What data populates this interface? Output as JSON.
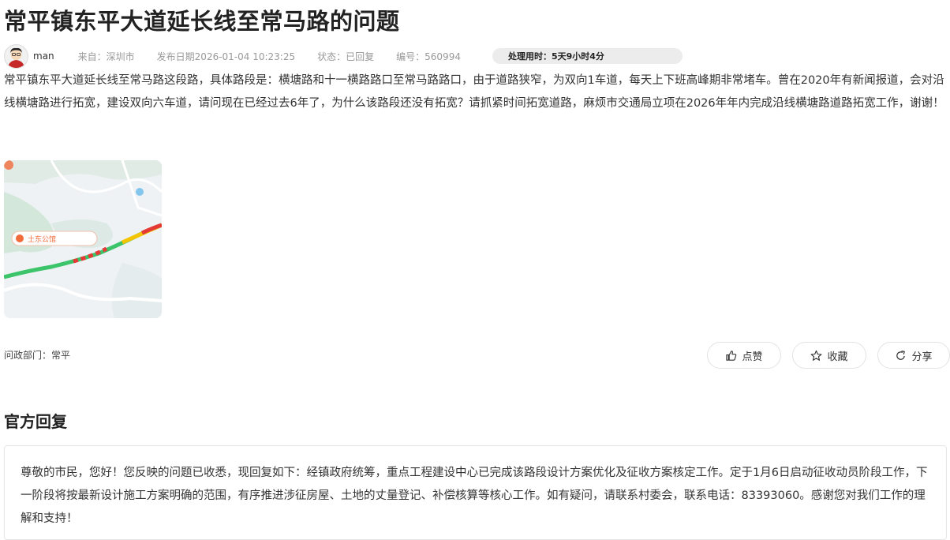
{
  "page": {
    "title": "常平镇东平大道延长线至常马路的问题"
  },
  "meta": {
    "username": "man",
    "source": "来自：深圳市",
    "publish_date": "发布日期2026-01-04 10:23:25",
    "status_label": "状态：",
    "status_value": "已回复",
    "number": "编号：560994",
    "processing_time": "处理用时：5天9小时4分"
  },
  "question": {
    "body": "常平镇东平大道延长线至常马路这段路，具体路段是：横塘路和十一横路路口至常马路路口，由于道路狭窄，为双向1车道，每天上下班高峰期非常堵车。曾在2020年有新闻报道，会对沿线横塘路进行拓宽，建设双向六车道，请问现在已经过去6年了，为什么该路段还没有拓宽？请抓紧时间拓宽道路，麻烦市交通局立项在2026年年内完成沿线横塘路道路拓宽工作，谢谢！"
  },
  "map": {
    "place_label": "土东公馆"
  },
  "department": {
    "text": "问政部门：常平"
  },
  "actions": {
    "like": "点赞",
    "favorite": "收藏",
    "share": "分享"
  },
  "official": {
    "heading": "官方回复",
    "reply": "尊敬的市民，您好！您反映的问题已收悉，现回复如下：经镇政府统筹，重点工程建设中心已完成该路段设计方案优化及征收方案核定工作。定于1月6日启动征收动员阶段工作，下一阶段将按最新设计施工方案明确的范围，有序推进涉征房屋、土地的丈量登记、补偿核算等核心工作。如有疑问，请联系村委会，联系电话：83393060。感谢您对我们工作的理解和支持！"
  },
  "colors": {
    "map_route_green": "#3cc46a",
    "map_route_red": "#e53935",
    "map_route_yellow": "#f5c400",
    "map_pin": "#f26b3a"
  }
}
